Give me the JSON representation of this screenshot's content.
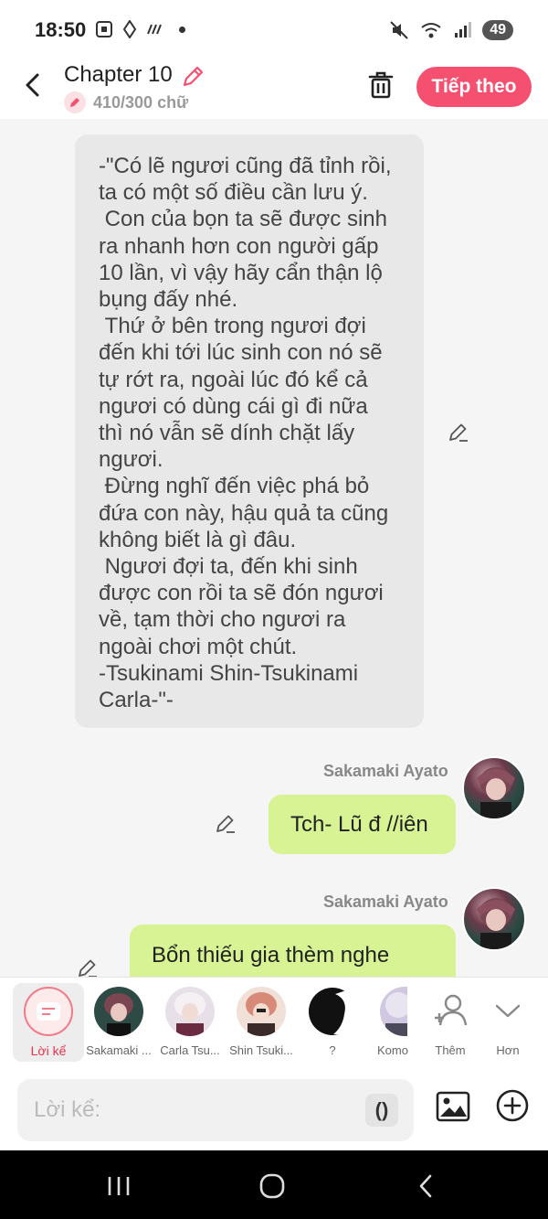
{
  "status_bar": {
    "time": "18:50",
    "battery": "49"
  },
  "header": {
    "title": "Chapter 10",
    "word_count": "410/300 chữ",
    "next_label": "Tiếp theo"
  },
  "narration": {
    "text": "-\"Có lẽ ngươi cũng đã tỉnh rồi,\nta có một số điều cần lưu ý.\n Con của bọn ta sẽ được sinh\nra nhanh hơn con người gấp\n10 lần, vì vậy hãy cẩn thận lộ\nbụng đấy nhé.\n Thứ ở bên trong ngươi đợi\nđến khi tới lúc sinh con nó sẽ\ntự rớt ra, ngoài lúc đó kể cả\nngươi có dùng cái gì đi nữa\nthì nó vẫn sẽ dính chặt lấy\nngươi.\n Đừng nghĩ đến việc phá bỏ\nđứa con này, hậu quả ta cũng\nkhông biết là gì đâu.\n Ngươi đợi ta, đến khi sinh\nđược con rồi ta sẽ đón ngươi\nvề, tạm thời cho ngươi ra\nngoài chơi một chút.\n-Tsukinami Shin-Tsukinami\nCarla-\"-"
  },
  "messages": [
    {
      "sender": "Sakamaki Ayato",
      "text": "Tch- Lũ đ //iên"
    },
    {
      "sender": "Sakamaki Ayato",
      "text": "Bổn thiếu gia thèm nghe"
    }
  ],
  "characters": [
    {
      "label": "Lời kể",
      "selected": true
    },
    {
      "label": "Sakamaki ..."
    },
    {
      "label": "Carla Tsu..."
    },
    {
      "label": "Shin Tsuki..."
    },
    {
      "label": "?"
    },
    {
      "label": "Komo"
    }
  ],
  "actions": {
    "more_label": "Thêm",
    "expand_label": "Hơn"
  },
  "input": {
    "placeholder": "Lời kể:",
    "paren_label": "()"
  },
  "colors": {
    "accent": "#f55070",
    "bubble": "#d8f394",
    "narration_bg": "#e8e8e8"
  }
}
